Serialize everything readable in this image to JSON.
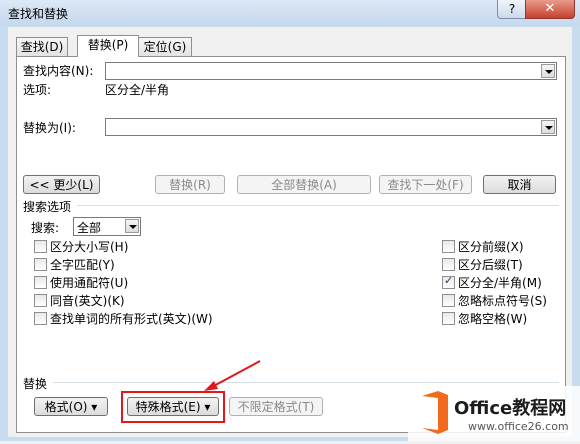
{
  "window": {
    "title": "查找和替换",
    "help": "?",
    "close": "✕"
  },
  "tabs": [
    {
      "label": "查找(D)",
      "active": false
    },
    {
      "label": "替换(P)",
      "active": true
    },
    {
      "label": "定位(G)",
      "active": false
    }
  ],
  "find": {
    "label": "查找内容(N):",
    "value": "",
    "options_label": "选项:",
    "options_value": "区分全/半角"
  },
  "replace": {
    "label": "替换为(I):",
    "value": ""
  },
  "buttons": {
    "less": "<< 更少(L)",
    "replace": "替换(R)",
    "replace_all": "全部替换(A)",
    "find_next": "查找下一处(F)",
    "cancel": "取消"
  },
  "search_options": {
    "heading": "搜索选项",
    "search_label": "搜索:",
    "search_value": "全部",
    "left": [
      {
        "label": "区分大小写(H)",
        "checked": false
      },
      {
        "label": "全字匹配(Y)",
        "checked": false
      },
      {
        "label": "使用通配符(U)",
        "checked": false
      },
      {
        "label": "同音(英文)(K)",
        "checked": false
      },
      {
        "label": "查找单词的所有形式(英文)(W)",
        "checked": false
      }
    ],
    "right": [
      {
        "label": "区分前缀(X)",
        "checked": false
      },
      {
        "label": "区分后缀(T)",
        "checked": false
      },
      {
        "label": "区分全/半角(M)",
        "checked": true
      },
      {
        "label": "忽略标点符号(S)",
        "checked": false
      },
      {
        "label": "忽略空格(W)",
        "checked": false
      }
    ]
  },
  "replace_section": {
    "heading": "替换",
    "format": "格式(O) ▾",
    "special": "特殊格式(E) ▾",
    "no_format": "不限定格式(T)"
  },
  "watermark": {
    "brand": "Office教程网",
    "url": "www.office26.com"
  },
  "colors": {
    "accent": "#e0181b",
    "logo_orange": "#f26b1d"
  }
}
